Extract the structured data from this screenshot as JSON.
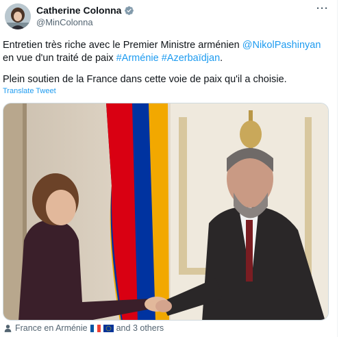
{
  "author": {
    "display_name": "Catherine Colonna",
    "handle": "@MinColonna",
    "verified": true
  },
  "tweet": {
    "line1_prefix": "Entretien très riche avec le Premier Ministre arménien ",
    "mention": "@NikolPashinyan",
    "line2_prefix": "en vue d'un traité de paix ",
    "hashtag1": "#Arménie",
    "hashtag2": "#Azerbaïdjan",
    "line2_suffix": ".",
    "paragraph2": "Plein soutien de la France dans cette voie de paix qu'il a choisie.",
    "translate_label": "Translate Tweet"
  },
  "tagged": {
    "account": "France en Arménie",
    "others": "and 3 others",
    "flags": [
      "france-flag",
      "eu-flag"
    ]
  },
  "icons": {
    "more": "more-icon",
    "verified": "verified-badge-icon",
    "tagged": "person-icon"
  },
  "colors": {
    "link": "#1d9bf0",
    "secondary_text": "#536471",
    "armenia_red": "#d90012",
    "armenia_blue": "#0033a0",
    "armenia_orange": "#f2a800"
  }
}
